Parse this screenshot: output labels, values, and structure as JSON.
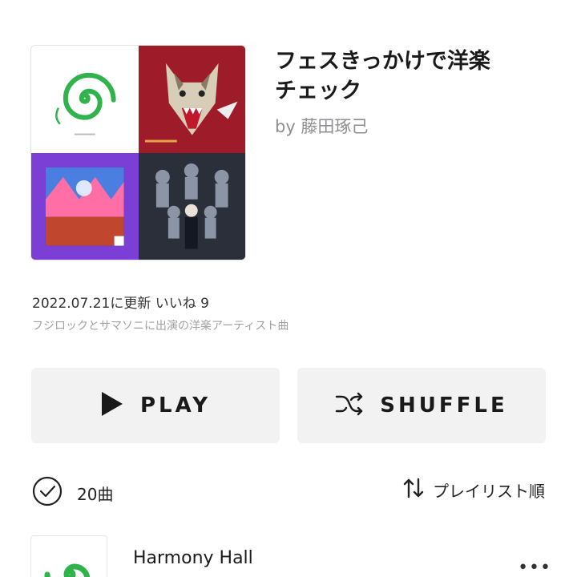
{
  "playlist": {
    "title_line1": "フェスきっかけで洋楽",
    "title_line2": "チェック",
    "author": "by 藤田琢己",
    "meta": "2022.07.21に更新 いいね 9",
    "description": "フジロックとサマソニに出演の洋楽アーティスト曲",
    "covers": [
      {
        "name": "spiral-snake-cover",
        "bg": "#ffffff",
        "accent": "#2fb34a"
      },
      {
        "name": "wolf-cover",
        "bg": "#9e1b2a",
        "accent": "#e8e0d0"
      },
      {
        "name": "neon-landscape-cover",
        "bg": "#7b3fd6",
        "accent": "#ff6fa5"
      },
      {
        "name": "figures-cover",
        "bg": "#2a2f3a",
        "accent": "#9aa3b3"
      }
    ]
  },
  "actions": {
    "play_label": "PLAY",
    "shuffle_label": "SHUFFLE"
  },
  "list": {
    "count": "20曲",
    "sort_label": "プレイリスト順"
  },
  "tracks": [
    {
      "title": "Harmony Hall",
      "more": "•••"
    }
  ],
  "colors": {
    "button_bg": "#f2f2f2",
    "text_primary": "#1a1a1a",
    "text_secondary": "#8e8e93"
  }
}
